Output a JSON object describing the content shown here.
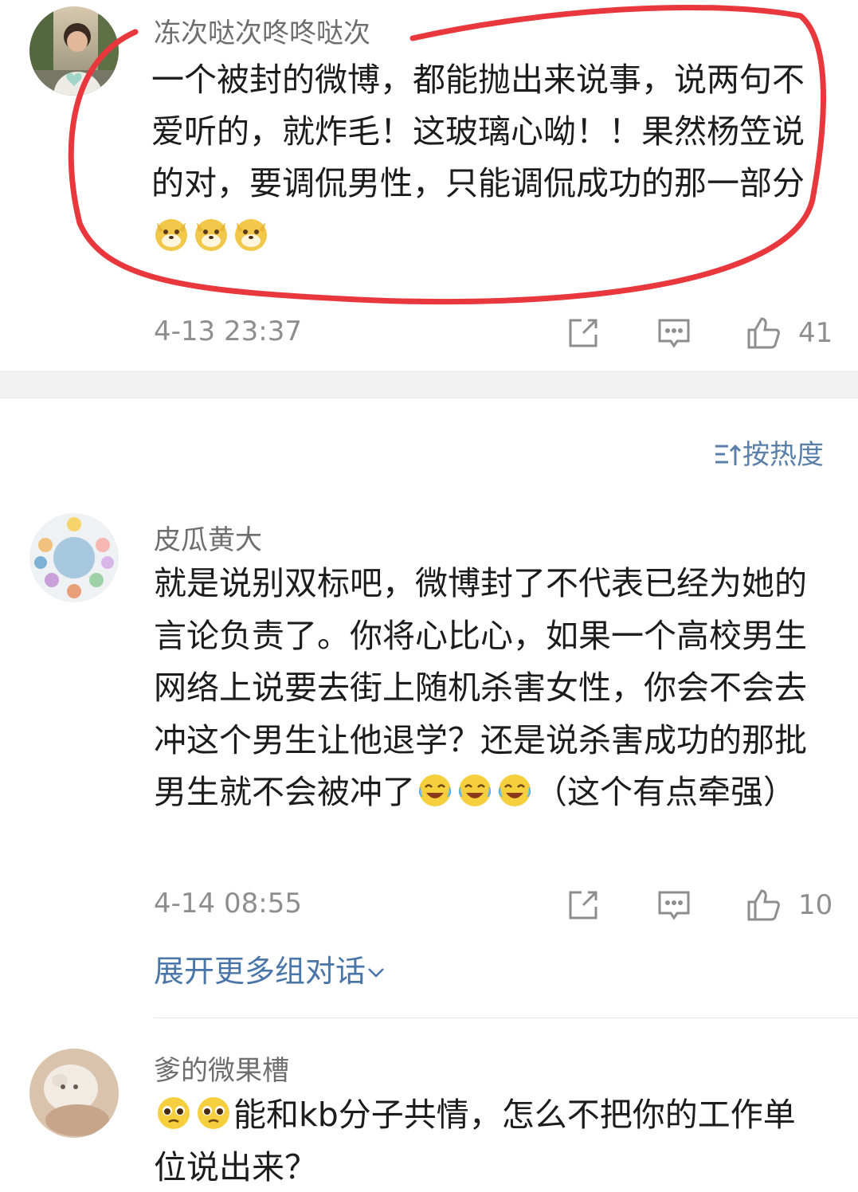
{
  "comments": [
    {
      "name": "冻次哒次咚咚哒次",
      "text": "一个被封的微博，都能抛出来说事，说两句不爱听的，就炸毛！这玻璃心呦！！果然杨笠说的对，要调侃男性，只能调侃成功的那一部分",
      "emoji": [
        "doge-emoji",
        "doge-emoji",
        "doge-emoji"
      ],
      "time": "4-13 23:37",
      "likes": "41"
    },
    {
      "name": "皮瓜黄大",
      "text": "就是说别双标吧，微博封了不代表已经为她的言论负责了。你将心比心，如果一个高校男生网络上说要去街上随机杀害女性，你会不会去冲这个男生让他退学？还是说杀害成功的那批男生就不会被冲了",
      "text_tail": "（这个有点牵强）",
      "emoji": [
        "laugh-cry-emoji",
        "laugh-cry-emoji",
        "laugh-cry-emoji"
      ],
      "time": "4-14 08:55",
      "likes": "10",
      "expand_label": "展开更多组对话"
    },
    {
      "name": "爹的微果槽",
      "text": "能和kb分子共情，怎么不把你的工作单位说出来？",
      "emoji": [
        "pleading-emoji",
        "pleading-emoji"
      ]
    }
  ],
  "sort_label": "按热度",
  "colors": {
    "accent_blue": "#4a75a8",
    "annotation_red": "#e8383d",
    "meta_gray": "#8e8e8e"
  }
}
